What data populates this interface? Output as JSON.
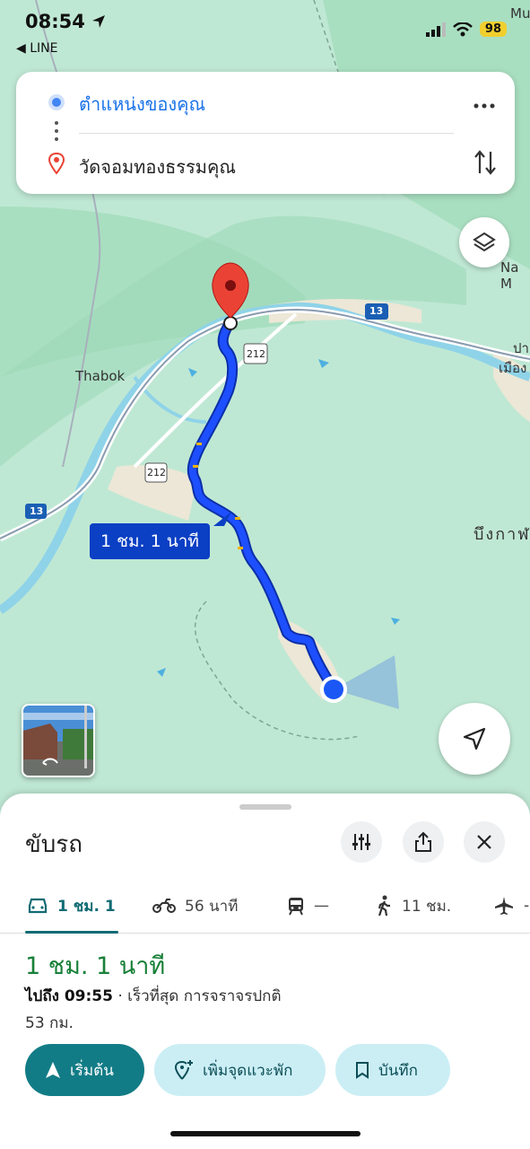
{
  "status_bar": {
    "time": "08:54",
    "back_app": "◀ LINE",
    "battery": "98"
  },
  "search": {
    "origin": "ตำแหน่งของคุณ",
    "destination": "วัดจอมทองธรรมคุณ"
  },
  "map": {
    "route_label": "1 ชม. 1 นาที",
    "labels": {
      "thabok": "Thabok",
      "mu": "Mu",
      "na_m": "Na M",
      "bueng": "บึงกาฬ",
      "pak": "ปา",
      "mueang": "เมือง",
      "road_13_a": "13",
      "road_13_b": "13",
      "road_212_a": "212",
      "road_212_b": "212"
    }
  },
  "sheet": {
    "title": "ขับรถ",
    "modes": [
      {
        "icon": "car-icon",
        "label": "1 ชม. 1"
      },
      {
        "icon": "motorcycle-icon",
        "label": "56 นาที"
      },
      {
        "icon": "transit-icon",
        "label": "—"
      },
      {
        "icon": "walk-icon",
        "label": "11 ชม."
      },
      {
        "icon": "flight-icon",
        "label": "-"
      }
    ],
    "eta": "1 ชม. 1 นาที",
    "arrive_label": "ไปถึง 09:55",
    "arrive_detail": " · เร็วที่สุด การจราจรปกติ",
    "distance": "53 กม.",
    "buttons": {
      "start": "เริ่มต้น",
      "add_stop": "เพิ่มจุดแวะพัก",
      "save": "บันทึก"
    }
  },
  "colors": {
    "route": "#1a3fe0",
    "accent": "#127c86",
    "eta_green": "#188038",
    "pin_red": "#ea4335"
  }
}
